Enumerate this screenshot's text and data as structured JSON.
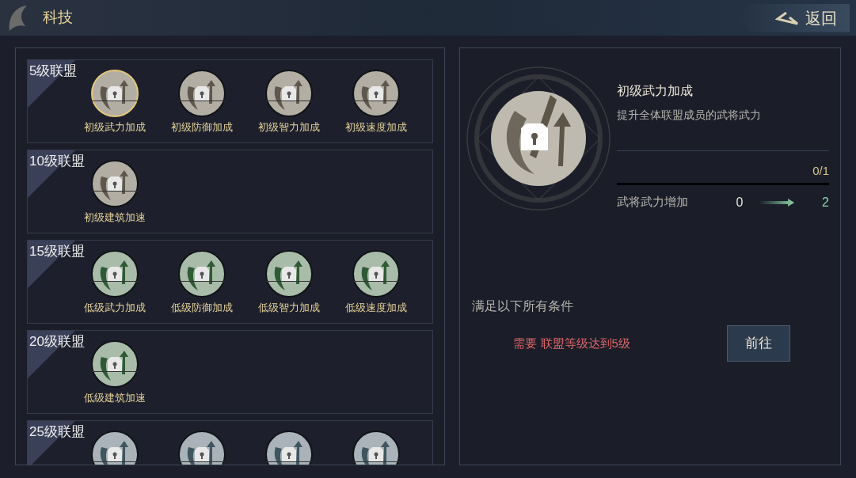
{
  "header": {
    "title": "科技",
    "back_label": "返回"
  },
  "tiers": [
    {
      "label": "5级联盟",
      "items": [
        {
          "label": "初级武力加成",
          "kind": "grey",
          "selected": true
        },
        {
          "label": "初级防御加成",
          "kind": "grey",
          "selected": false
        },
        {
          "label": "初级智力加成",
          "kind": "grey",
          "selected": false
        },
        {
          "label": "初级速度加成",
          "kind": "grey",
          "selected": false
        }
      ]
    },
    {
      "label": "10级联盟",
      "items": [
        {
          "label": "初级建筑加速",
          "kind": "grey",
          "selected": false
        }
      ]
    },
    {
      "label": "15级联盟",
      "items": [
        {
          "label": "低级武力加成",
          "kind": "green",
          "selected": false
        },
        {
          "label": "低级防御加成",
          "kind": "green",
          "selected": false
        },
        {
          "label": "低级智力加成",
          "kind": "green",
          "selected": false
        },
        {
          "label": "低级速度加成",
          "kind": "green",
          "selected": false
        }
      ]
    },
    {
      "label": "20级联盟",
      "items": [
        {
          "label": "低级建筑加速",
          "kind": "green",
          "selected": false
        }
      ]
    },
    {
      "label": "25级联盟",
      "items": [
        {
          "kind": "slate",
          "selected": false
        },
        {
          "kind": "slate",
          "selected": false
        },
        {
          "kind": "slate",
          "selected": false
        },
        {
          "kind": "slate",
          "selected": false
        }
      ]
    }
  ],
  "detail": {
    "title": "初级武力加成",
    "description": "提升全体联盟成员的武将武力",
    "progress": "0/1",
    "level": 0,
    "stat": {
      "label": "武将武力增加",
      "from": "0",
      "to": "2"
    },
    "conditions_title": "满足以下所有条件",
    "requirement": "需要 联盟等级达到5级",
    "go_button": "前往"
  }
}
